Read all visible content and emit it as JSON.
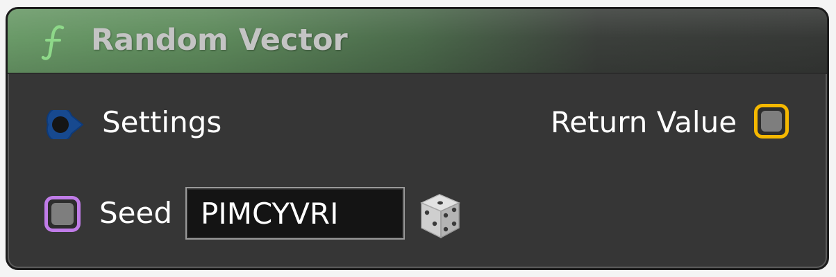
{
  "node": {
    "title": "Random Vector",
    "icon": "function-icon",
    "header_color": "#6a9a68",
    "inputs": {
      "exec": {
        "label": "Settings",
        "icon": "exec-pin-icon",
        "color": "#1e5bb8"
      },
      "seed": {
        "label": "Seed",
        "value": "PIMCYVRI",
        "pin_color": "#c07ce8",
        "randomize_icon": "dice-icon"
      }
    },
    "outputs": {
      "return": {
        "label": "Return Value",
        "pin_color": "#f5b800"
      }
    }
  }
}
